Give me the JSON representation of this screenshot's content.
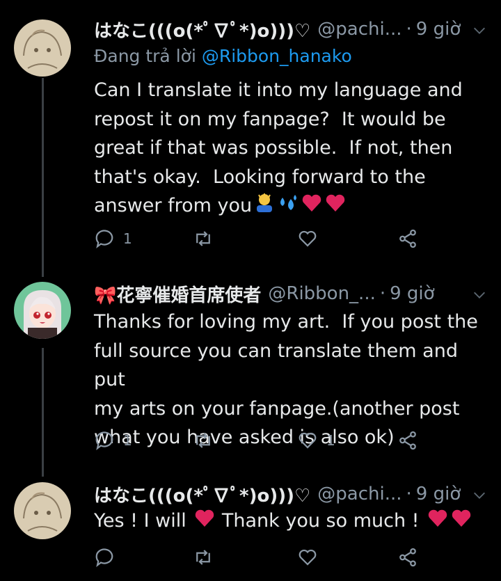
{
  "tweets": [
    {
      "name": "はなこ(((o(*ﾟ∇ﾟ*)o)))♡",
      "handle": "@pachi...",
      "separator": "·",
      "time": "9 giờ",
      "reply_prefix": "Đang trả lời ",
      "reply_mention": "@Ribbon_hanako",
      "text": "Can I translate it into my language and\nrepost it on my fanpage?  It would be\ngreat if that was possible.  If not, then\nthat's okay.  Looking forward to the\nanswer from you",
      "reply_count": "1",
      "like_count": ""
    },
    {
      "name": "🎀花寧催婚首席使者",
      "handle": "@Ribbon_...",
      "separator": "·",
      "time": "9 giờ",
      "text": "Thanks for loving my art.  If you post the\nfull source you can translate them and put\nmy arts on your fanpage.(another post\nwhat you have asked is also ok)",
      "reply_count": "1",
      "like_count": "1"
    },
    {
      "name": "はなこ(((o(*ﾟ∇ﾟ*)o)))♡",
      "handle": "@pachi...",
      "separator": "·",
      "time": "9 giờ",
      "text_part1": "Yes ! I will ",
      "text_part2": " Thank you so much ! ",
      "reply_count": "",
      "like_count": ""
    }
  ],
  "colors": {
    "background": "#000000",
    "text": "#e7e9ea",
    "muted": "#8b98a5",
    "mention": "#1d9bf0",
    "heart": "#e0245e"
  },
  "icons": [
    "reply-icon",
    "retweet-icon",
    "like-icon",
    "share-icon",
    "caret-down-icon"
  ]
}
